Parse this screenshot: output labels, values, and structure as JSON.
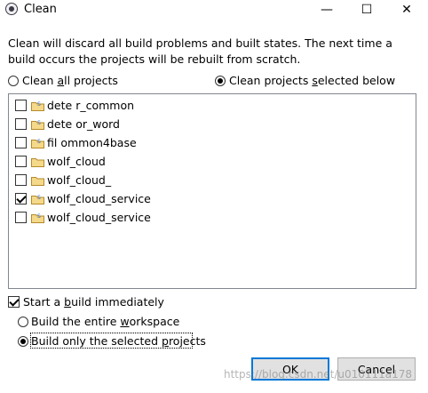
{
  "window": {
    "title": "Clean",
    "min_glyph": "—",
    "max_glyph": "☐",
    "close_glyph": "✕"
  },
  "description": "Clean will discard all build problems and built states.  The next time a build occurs the projects will be rebuilt from scratch.",
  "scope": {
    "all_pre": "Clean ",
    "all_u": "a",
    "all_post": "ll projects",
    "selected_pre": "Clean projects ",
    "selected_u": "s",
    "selected_post": "elected below",
    "selected_option": "selected"
  },
  "projects": [
    {
      "name": "dete   r_common",
      "checked": false
    },
    {
      "name": "dete   or_word",
      "checked": false
    },
    {
      "name": "fil   ommon4base",
      "checked": false
    },
    {
      "name": "wolf_cloud",
      "checked": false
    },
    {
      "name": "wolf_cloud_",
      "checked": false
    },
    {
      "name": "wolf_cloud_service",
      "checked": true
    },
    {
      "name": "wolf_cloud_service",
      "checked": false
    }
  ],
  "start_build": {
    "pre": "Start a ",
    "u": "b",
    "post": "uild immediately",
    "checked": true
  },
  "build_scope": {
    "entire_pre": "Build the entire ",
    "entire_u": "w",
    "entire_post": "orkspace",
    "only_pre": "Build only the selected ",
    "only_u": "p",
    "only_post": "rojects",
    "selected_option": "only"
  },
  "buttons": {
    "ok": "OK",
    "cancel": "Cancel"
  },
  "icon_names": {
    "app": "eclipse-icon",
    "project": "java-project-folder-icon"
  },
  "watermark": "https://blog.csdn.net/u010111a178"
}
